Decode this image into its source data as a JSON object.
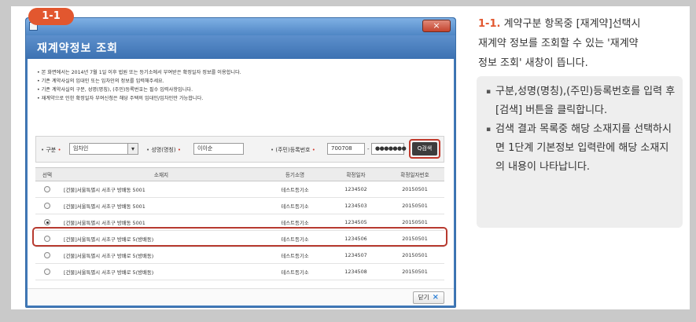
{
  "badge": "1-1",
  "window": {
    "title": "재계약정보 조회",
    "close_symbol": "×"
  },
  "notes": [
    "• 본 화면에서는 2014년 7월 1일 이후 법원 또는 등기소에서 부여받은 확정일자 정보를 이용합니다.",
    "• 기존 계약사실의 임대인 또는 임차인의 정보를 입력해주세요.",
    "• 기존 계약사실의 구분, 성명(명칭), (주민)등록번호는 필수 입력사항입니다.",
    "• 재계약으로 인한 확정일자 부여신청은 해당 주택의 임대인/임차인만 가능합니다."
  ],
  "search": {
    "type_label": "구분",
    "type_value": "임차인",
    "name_label": "성명(명칭)",
    "name_value": "이이순",
    "id_label": "(주민)등록번호",
    "id_front": "700708",
    "id_sep": "-",
    "id_back": "●●●●●●●",
    "search_button": "Q검색"
  },
  "table": {
    "headers": [
      "선택",
      "소재지",
      "등기소명",
      "확정일자",
      "확정일자번호"
    ],
    "rows": [
      {
        "address": "[건물]서울특별시 서초구 방배동 5001",
        "office": "테스트등기소",
        "number": "1234502",
        "date": "20150501",
        "selected": false
      },
      {
        "address": "[건물]서울특별시 서초구 방배동 5001",
        "office": "테스트등기소",
        "number": "1234503",
        "date": "20150501",
        "selected": false
      },
      {
        "address": "[건물]서울특별시 서초구 방배동 5001",
        "office": "테스트등기소",
        "number": "1234505",
        "date": "20150501",
        "selected": true
      },
      {
        "address": "[건물]서울특별시 서초구 방배로 5(방배동)",
        "office": "테스트등기소",
        "number": "1234506",
        "date": "20150501",
        "selected": false
      },
      {
        "address": "[건물]서울특별시 서초구 방배로 5(방배동)",
        "office": "테스트등기소",
        "number": "1234507",
        "date": "20150501",
        "selected": false
      },
      {
        "address": "[건물]서울특별시 서초구 방배로 5(방배동)",
        "office": "테스트등기소",
        "number": "1234508",
        "date": "20150501",
        "selected": false
      }
    ]
  },
  "footer": {
    "close_button": "닫기",
    "close_icon": "×"
  },
  "explanation": {
    "number": "1-1.",
    "lines": [
      "계약구분 항목중 [재계약]선택시",
      "재계약 정보를 조회할 수 있는 '재계약",
      "정보 조회' 새창이 뜹니다."
    ],
    "bullets": [
      "구분,성명(명칭),(주민)등록번호를 입력 후 [검색] 버튼을 클릭합니다.",
      "검색 결과 목록중 해당 소재지를 선택하시면 1단계 기본정보 입력란에 해당 소재지의 내용이 나타납니다."
    ]
  },
  "colors": {
    "accent": "#e2572f",
    "title_bar": "#4a80c0",
    "highlight": "#b73a2f"
  }
}
